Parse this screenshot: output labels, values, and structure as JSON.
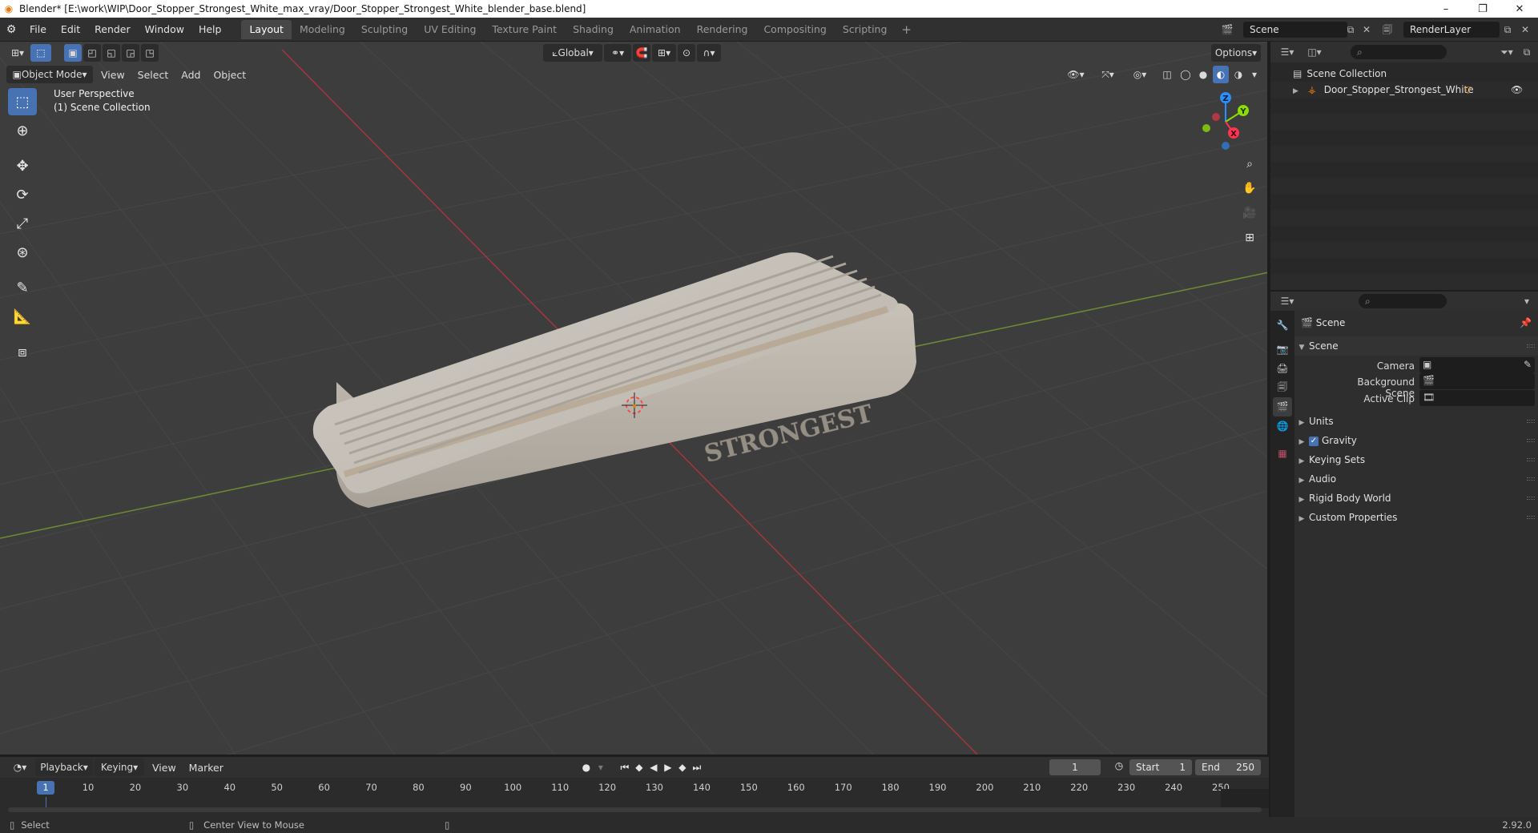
{
  "window": {
    "title": "Blender* [E:\\work\\WIP\\Door_Stopper_Strongest_White_max_vray/Door_Stopper_Strongest_White_blender_base.blend]",
    "minimize": "–",
    "maximize": "❐",
    "close": "✕"
  },
  "menu": {
    "items": [
      "File",
      "Edit",
      "Render",
      "Window",
      "Help"
    ]
  },
  "workspaces": {
    "tabs": [
      "Layout",
      "Modeling",
      "Sculpting",
      "UV Editing",
      "Texture Paint",
      "Shading",
      "Animation",
      "Rendering",
      "Compositing",
      "Scripting"
    ],
    "active": "Layout",
    "add": "+"
  },
  "topbar": {
    "scene_name": "Scene",
    "view_layer": "RenderLayer"
  },
  "viewport": {
    "mode": "Object Mode",
    "menus": [
      "View",
      "Select",
      "Add",
      "Object"
    ],
    "orientation": "Global",
    "options": "Options",
    "perspective_label": "User Perspective",
    "collection_label": "(1) Scene Collection",
    "object_text": "STRONGEST",
    "gizmo": {
      "x": "X",
      "y": "Y",
      "z": "Z"
    }
  },
  "outliner": {
    "root": "Scene Collection",
    "object": "Door_Stopper_Strongest_White"
  },
  "properties": {
    "context": "Scene",
    "panel": "Scene",
    "fields": {
      "camera": "Camera",
      "background_scene": "Background Scene",
      "active_clip": "Active Clip"
    },
    "subpanels": [
      "Units",
      "Gravity",
      "Keying Sets",
      "Audio",
      "Rigid Body World",
      "Custom Properties"
    ],
    "gravity_checked": "✓"
  },
  "timeline": {
    "menus": [
      "Playback",
      "Keying",
      "View",
      "Marker"
    ],
    "current_frame": "1",
    "start_label": "Start",
    "start": "1",
    "end_label": "End",
    "end": "250",
    "ticks": [
      "1",
      "10",
      "20",
      "30",
      "40",
      "50",
      "60",
      "70",
      "80",
      "90",
      "100",
      "110",
      "120",
      "130",
      "140",
      "150",
      "160",
      "170",
      "180",
      "190",
      "200",
      "210",
      "220",
      "230",
      "240",
      "250"
    ]
  },
  "statusbar": {
    "select": "Select",
    "center_view": "Center View to Mouse",
    "version": "2.92.0"
  },
  "colors": {
    "accent": "#4772b3",
    "x_axis": "#ff3352",
    "y_axis": "#8bdc00",
    "z_axis": "#2890ff",
    "object_orange": "#e87d0d"
  }
}
